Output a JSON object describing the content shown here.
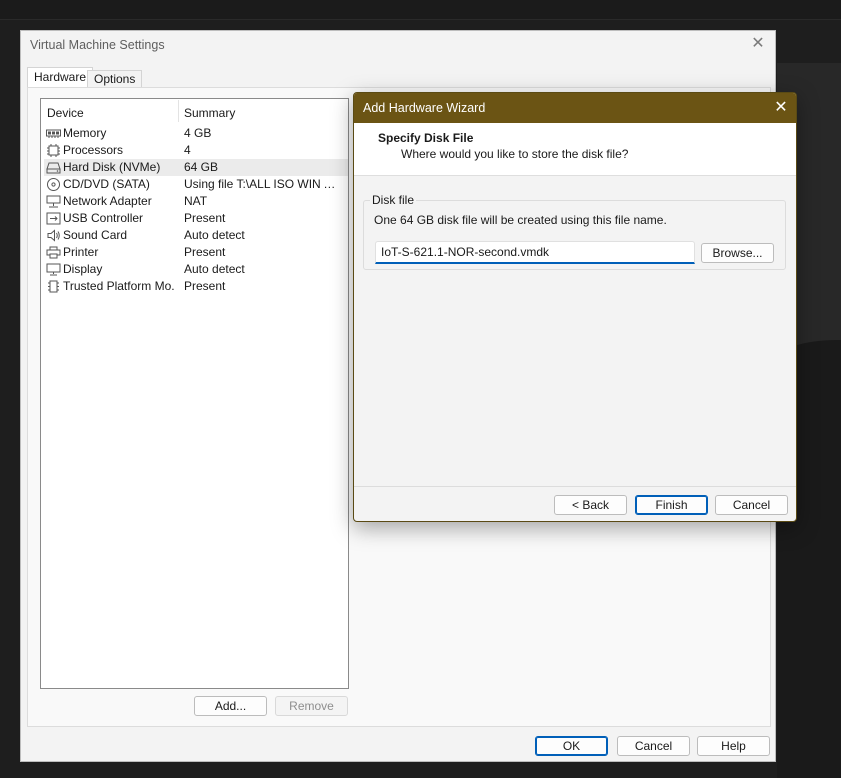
{
  "window": {
    "title": "Virtual Machine Settings",
    "tabs": [
      {
        "label": "Hardware"
      },
      {
        "label": "Options"
      }
    ],
    "columns": {
      "device": "Device",
      "summary": "Summary"
    },
    "devices": [
      {
        "name": "Memory",
        "summary": "4 GB",
        "icon": "memory-icon"
      },
      {
        "name": "Processors",
        "summary": "4",
        "icon": "processor-icon"
      },
      {
        "name": "Hard Disk (NVMe)",
        "summary": "64 GB",
        "icon": "hard-disk-icon"
      },
      {
        "name": "CD/DVD (SATA)",
        "summary": "Using file T:\\ALL ISO WIN AN...",
        "icon": "cd-dvd-icon"
      },
      {
        "name": "Network Adapter",
        "summary": "NAT",
        "icon": "network-icon"
      },
      {
        "name": "USB Controller",
        "summary": "Present",
        "icon": "usb-icon"
      },
      {
        "name": "Sound Card",
        "summary": "Auto detect",
        "icon": "speaker-icon"
      },
      {
        "name": "Printer",
        "summary": "Present",
        "icon": "printer-icon"
      },
      {
        "name": "Display",
        "summary": "Auto detect",
        "icon": "monitor-icon"
      },
      {
        "name": "Trusted Platform Mo...",
        "summary": "Present",
        "icon": "tpm-chip-icon"
      }
    ],
    "add_label": "Add...",
    "remove_label": "Remove",
    "ok_label": "OK",
    "cancel_label": "Cancel",
    "help_label": "Help"
  },
  "wizard": {
    "title": "Add Hardware Wizard",
    "heading": "Specify Disk File",
    "subheading": "Where would you like to store the disk file?",
    "group_label": "Disk file",
    "description": "One 64 GB disk file will be created using this file name.",
    "file_name": "IoT-S-621.1-NOR-second.vmdk",
    "browse_label": "Browse...",
    "back_label": "< Back",
    "finish_label": "Finish",
    "cancel_label": "Cancel"
  },
  "colors": {
    "wizard_titlebar": "#6b5414",
    "accent": "#005fb8"
  }
}
